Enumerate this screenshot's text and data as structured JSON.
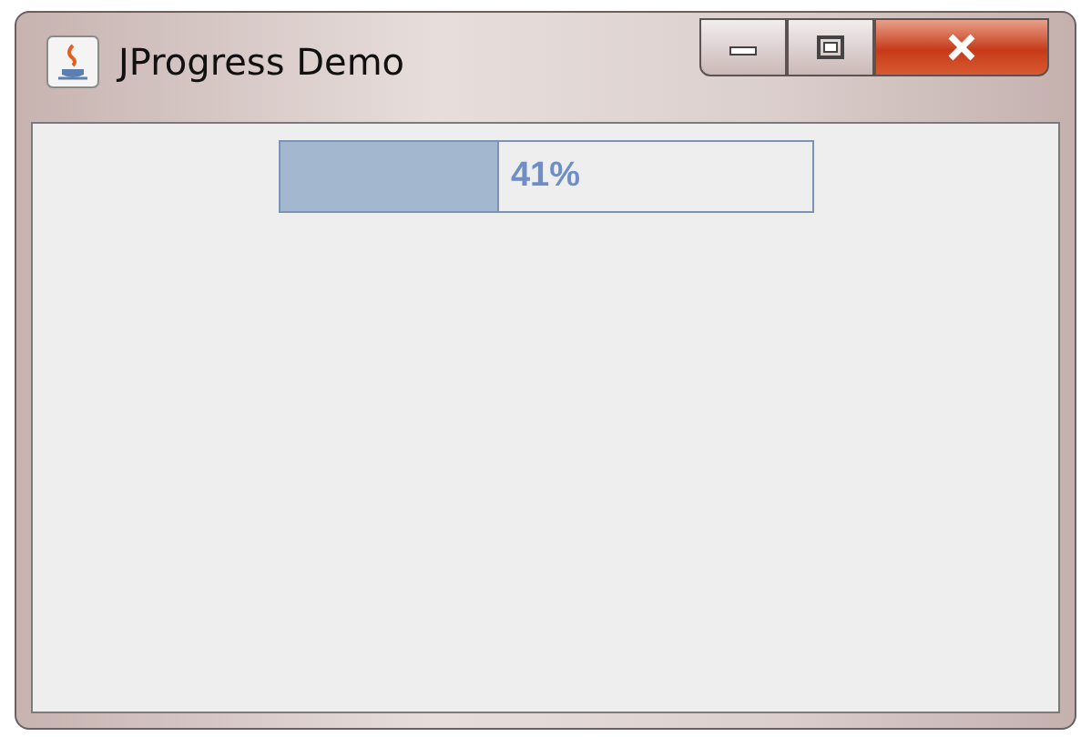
{
  "window": {
    "title": "JProgress Demo"
  },
  "progress": {
    "level": 0.41,
    "reading": "41%"
  }
}
